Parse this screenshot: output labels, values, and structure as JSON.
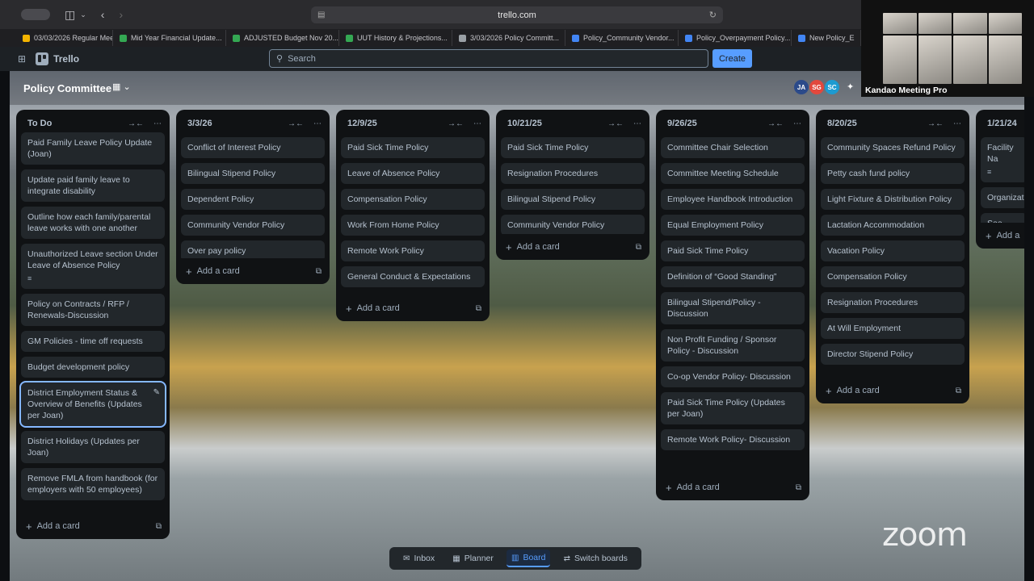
{
  "browser": {
    "url": "trello.com",
    "tabs": [
      {
        "label": "03/03/2026 Regular Meeti...",
        "color": "#f4b400"
      },
      {
        "label": "Mid Year Financial Update...",
        "color": "#34a853"
      },
      {
        "label": "ADJUSTED Budget Nov 20...",
        "color": "#34a853"
      },
      {
        "label": "UUT History & Projections...",
        "color": "#34a853"
      },
      {
        "label": "3/03/2026 Policy Committ...",
        "color": "#9aa0a6"
      },
      {
        "label": "Policy_Community Vendor...",
        "color": "#4285f4"
      },
      {
        "label": "Policy_Overpayment Policy...",
        "color": "#4285f4"
      },
      {
        "label": "New Policy_E",
        "color": "#4285f4"
      }
    ]
  },
  "header": {
    "app_name": "Trello",
    "search_placeholder": "Search",
    "create_label": "Create"
  },
  "board": {
    "title": "Policy Committee",
    "members": [
      {
        "initials": "JA",
        "color": "#2b4a8a"
      },
      {
        "initials": "SG",
        "color": "#e2483d"
      },
      {
        "initials": "SC",
        "color": "#1d9bd1"
      }
    ],
    "add_card_label": "Add a card",
    "lists": [
      {
        "title": "To Do",
        "cards": [
          {
            "text": "Paid Family Leave Policy Update (Joan)"
          },
          {
            "text": "Update paid family leave to integrate disability"
          },
          {
            "text": "Outline how each family/parental leave works with one another"
          },
          {
            "text": "Unauthorized Leave section Under Leave of Absence Policy",
            "has_description": true
          },
          {
            "text": "Policy on Contracts / RFP / Renewals-Discussion"
          },
          {
            "text": "GM Policies - time off requests"
          },
          {
            "text": "Budget development policy"
          },
          {
            "text": "District Employment Status & Overview of Benefits (Updates per Joan)",
            "selected": true
          },
          {
            "text": "District Holidays (Updates per Joan)"
          },
          {
            "text": "Remove FMLA from handbook (for employers with 50 employees)"
          }
        ]
      },
      {
        "title": "3/3/26",
        "cards": [
          {
            "text": "Conflict of Interest Policy"
          },
          {
            "text": "Bilingual Stipend Policy"
          },
          {
            "text": "Dependent Policy"
          },
          {
            "text": "Community Vendor Policy"
          },
          {
            "text": "Over pay policy"
          }
        ]
      },
      {
        "title": "12/9/25",
        "cards": [
          {
            "text": "Paid Sick Time Policy"
          },
          {
            "text": "Leave of Absence Policy"
          },
          {
            "text": "Compensation Policy"
          },
          {
            "text": "Work From Home Policy"
          },
          {
            "text": "Remote Work Policy"
          },
          {
            "text": "General Conduct & Expectations"
          }
        ]
      },
      {
        "title": "10/21/25",
        "cards": [
          {
            "text": "Paid Sick Time Policy"
          },
          {
            "text": "Resignation Procedures"
          },
          {
            "text": "Bilingual Stipend Policy"
          },
          {
            "text": "Community Vendor Policy"
          }
        ]
      },
      {
        "title": "9/26/25",
        "cards": [
          {
            "text": "Committee Chair Selection"
          },
          {
            "text": "Committee Meeting Schedule"
          },
          {
            "text": "Employee Handbook Introduction"
          },
          {
            "text": "Equal Employment Policy"
          },
          {
            "text": "Paid Sick Time Policy"
          },
          {
            "text": "Definition of “Good Standing”"
          },
          {
            "text": "Bilingual Stipend/Policy - Discussion"
          },
          {
            "text": "Non Profit Funding / Sponsor Policy - Discussion"
          },
          {
            "text": "Co-op Vendor Policy- Discussion"
          },
          {
            "text": "Paid Sick Time Policy (Updates per Joan)"
          },
          {
            "text": "Remote Work Policy- Discussion"
          }
        ]
      },
      {
        "title": "8/20/25",
        "cards": [
          {
            "text": "Community Spaces Refund Policy"
          },
          {
            "text": "Petty cash fund policy"
          },
          {
            "text": "Light Fixture & Distribution Policy"
          },
          {
            "text": "Lactation Accommodation"
          },
          {
            "text": "Vacation Policy"
          },
          {
            "text": "Compensation Policy"
          },
          {
            "text": "Resignation Procedures"
          },
          {
            "text": "At Will Employment"
          },
          {
            "text": "Director Stipend Policy"
          }
        ]
      },
      {
        "title": "1/21/24",
        "cards": [
          {
            "text": "Facility Na",
            "has_description": true
          },
          {
            "text": "Organizat"
          },
          {
            "text": "See Polici"
          }
        ],
        "add_card_label": "Add a"
      }
    ]
  },
  "switcher": [
    {
      "label": "Inbox",
      "icon": "inbox-icon",
      "glyph": "✉"
    },
    {
      "label": "Planner",
      "icon": "calendar-icon",
      "glyph": "▦"
    },
    {
      "label": "Board",
      "icon": "board-icon",
      "glyph": "▥",
      "active": true
    },
    {
      "label": "Switch boards",
      "icon": "switch-boards-icon",
      "glyph": "⇄"
    }
  ],
  "zoom": {
    "room_label": "Kandao Meeting Pro",
    "logo": "zoom"
  }
}
